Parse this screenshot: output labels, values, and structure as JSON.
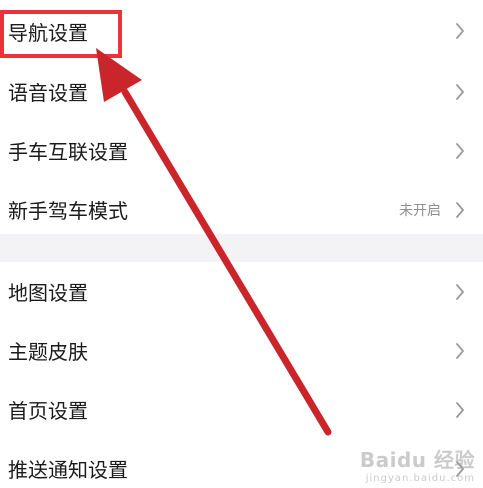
{
  "settings": {
    "group1": [
      {
        "label": "导航设置",
        "status": ""
      },
      {
        "label": "语音设置",
        "status": ""
      },
      {
        "label": "手车互联设置",
        "status": ""
      },
      {
        "label": "新手驾车模式",
        "status": "未开启"
      }
    ],
    "group2": [
      {
        "label": "地图设置",
        "status": ""
      },
      {
        "label": "主题皮肤",
        "status": ""
      },
      {
        "label": "首页设置",
        "status": ""
      },
      {
        "label": "推送通知设置",
        "status": ""
      }
    ]
  },
  "annotation": {
    "color": "#e8333a",
    "arrow_color": "#c9252b"
  },
  "watermark": {
    "main": "Baidu 经验",
    "sub": "jingyan.baidu.com"
  },
  "colors": {
    "text": "#1b1b1b",
    "status": "#8e8e93",
    "chevron": "#9a9a9f",
    "divider": "#f3f3f5"
  }
}
